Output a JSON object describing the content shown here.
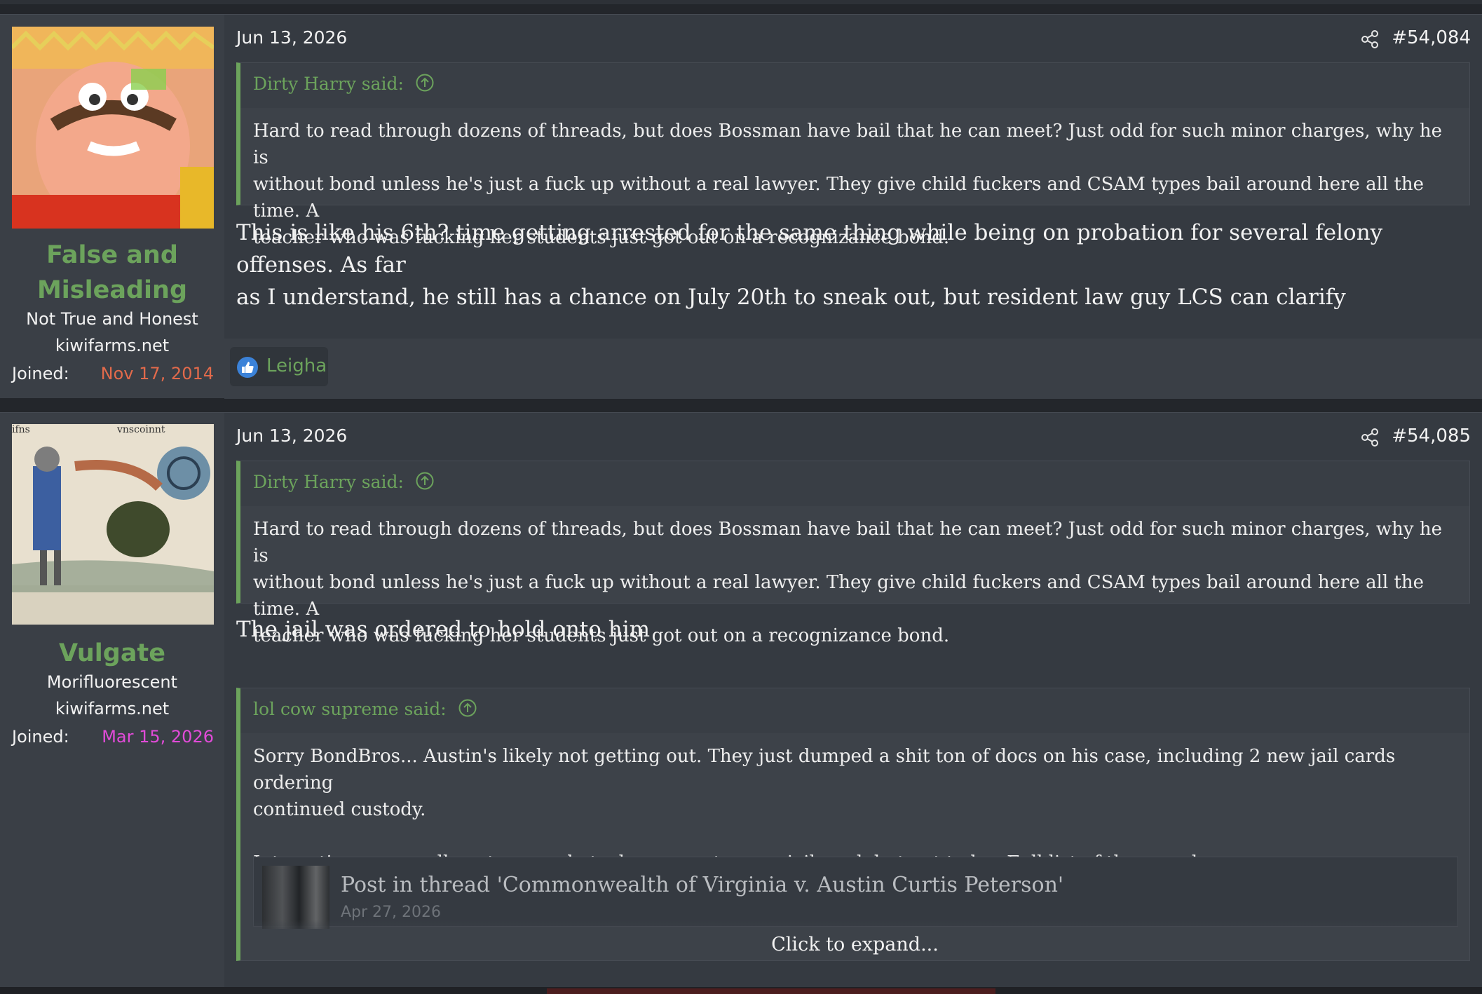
{
  "posts": [
    {
      "author": {
        "name": "False and Misleading",
        "name_line1": "False and",
        "name_line2": "Misleading",
        "title": "Not True and Honest",
        "site": "kiwifarms.net",
        "joined_label": "Joined:",
        "joined_date": "Nov 17, 2014",
        "joined_color": "#e26a4b"
      },
      "date": "Jun 13, 2026",
      "post_number": "#54,084",
      "quotes": [
        {
          "author_said": "Dirty Harry said:",
          "lines": [
            "Hard to read through dozens of threads, but does Bossman have bail that he can meet? Just odd for such minor charges, why he is",
            "without bond unless he's just a fuck up without a real lawyer. They give child fuckers and CSAM types bail around here all the time. A",
            "teacher who was fucking her students just got out on a recognizance bond."
          ]
        }
      ],
      "body_lines": [
        "This is like his 6th? time getting arrested for the same thing while being on probation for several felony offenses. As far",
        "as I understand, he still has a chance on July 20th to sneak out, but resident law guy LCS can clarify"
      ],
      "reactions": {
        "icon": "like-icon",
        "users": "Leigha"
      }
    },
    {
      "author": {
        "name": "Vulgate",
        "title": "Morifluorescent",
        "site": "kiwifarms.net",
        "joined_label": "Joined:",
        "joined_date": "Mar 15, 2026",
        "joined_color": "#e24bd9"
      },
      "date": "Jun 13, 2026",
      "post_number": "#54,085",
      "quotes": [
        {
          "author_said": "Dirty Harry said:",
          "lines": [
            "Hard to read through dozens of threads, but does Bossman have bail that he can meet? Just odd for such minor charges, why he is",
            "without bond unless he's just a fuck up without a real lawyer. They give child fuckers and CSAM types bail around here all the time. A",
            "teacher who was fucking her students just got out on a recognizance bond."
          ]
        },
        {
          "author_said": "lol cow supreme said:",
          "lines": [
            "Sorry BondBros... Austin's likely not getting out. They just dumped a shit ton of docs on his case, including 2 new jail cards ordering",
            "continued custody.",
            "Interesting we usually get a mugshot when we get a new jail card, but not today. Full list of the new docs"
          ],
          "embed": {
            "title": "Post in thread 'Commonwealth of Virginia v. Austin Curtis Peterson'",
            "date": "Apr 27, 2026"
          },
          "expand_label": "Click to expand..."
        }
      ],
      "body_lines": [
        "The jail was ordered to hold onto him"
      ]
    }
  ],
  "colors": {
    "accent_green": "#6ca35c",
    "background": "#353a41"
  },
  "icons": {
    "share": "share-icon",
    "quote_jump": "arrow-up-circle-icon",
    "like": "like-icon"
  }
}
